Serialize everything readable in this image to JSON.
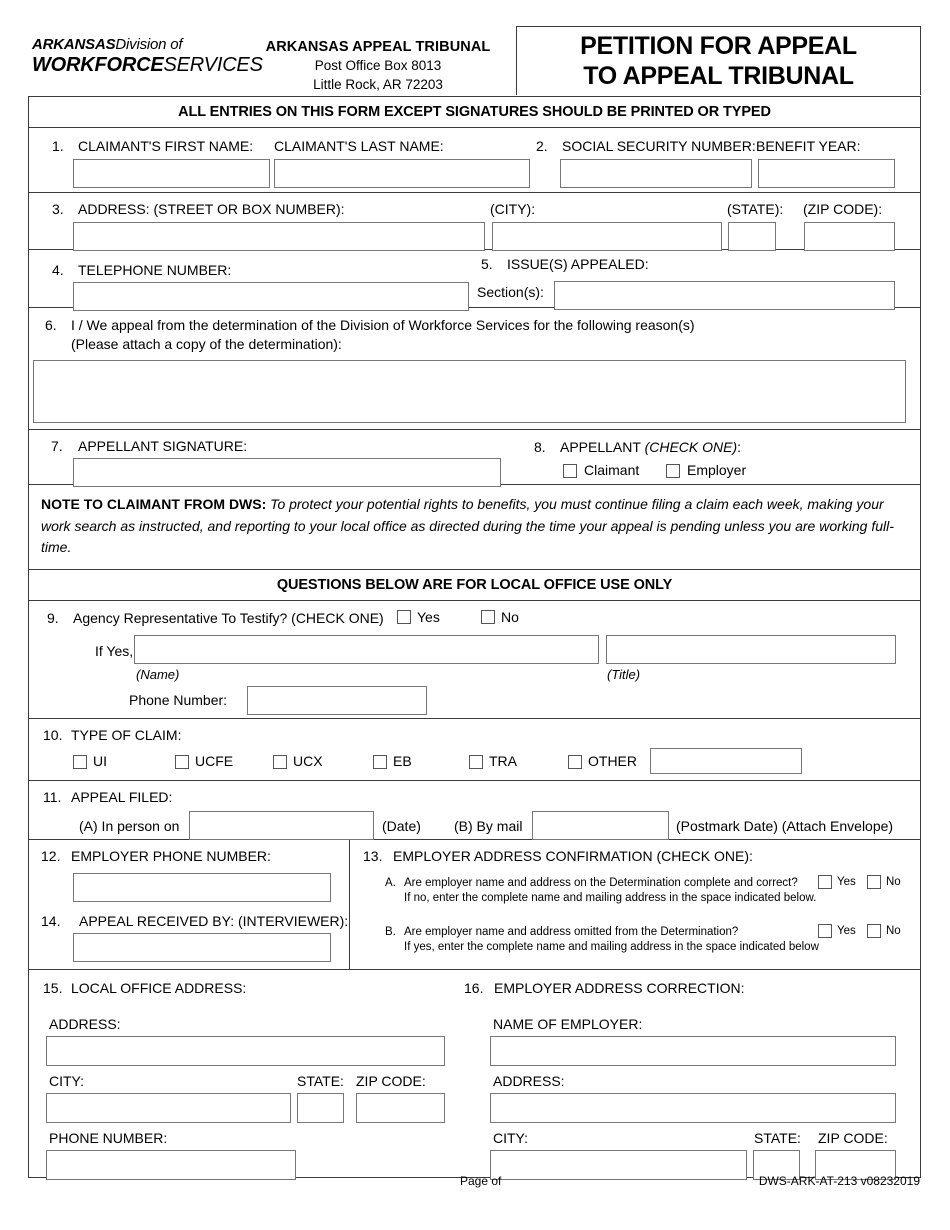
{
  "header": {
    "logo_line1_bold": "ARKANSAS",
    "logo_line1_italic": "Division of",
    "logo_line2_bold": "WORKFORCE",
    "logo_line2_italic": "SERVICES",
    "agency_name": "ARKANSAS APPEAL TRIBUNAL",
    "agency_po_box": "Post Office Box 8013",
    "agency_city_state_zip": "Little Rock, AR  72203",
    "title_line1": "PETITION FOR APPEAL",
    "title_line2": "TO APPEAL TRIBUNAL"
  },
  "banners": {
    "printed_or_typed": "ALL ENTRIES ON THIS FORM EXCEPT SIGNATURES SHOULD BE PRINTED OR TYPED",
    "local_office_only": "QUESTIONS BELOW ARE FOR LOCAL OFFICE USE ONLY"
  },
  "item1": {
    "number": "1.",
    "first_name_label": "CLAIMANT'S FIRST NAME:",
    "last_name_label": "CLAIMANT'S LAST NAME:",
    "first_name_value": "",
    "last_name_value": ""
  },
  "item2": {
    "number": "2.",
    "ssn_label": "SOCIAL SECURITY NUMBER:",
    "benefit_year_label": "BENEFIT YEAR:",
    "ssn_value": "",
    "benefit_year_value": ""
  },
  "item3": {
    "number": "3.",
    "address_label": "ADDRESS: (STREET OR BOX NUMBER):",
    "city_label": "(CITY):",
    "state_label": "(STATE):",
    "zip_label": "(ZIP CODE):",
    "address_value": "",
    "city_value": "",
    "state_value": "",
    "zip_value": ""
  },
  "item4": {
    "number": "4.",
    "label": "TELEPHONE NUMBER:",
    "value": ""
  },
  "item5": {
    "number": "5.",
    "label": "ISSUE(S) APPEALED:",
    "sections_label": "Section(s):",
    "sections_value": ""
  },
  "item6": {
    "number": "6.",
    "line1": "I / We appeal from the determination of the Division of Workforce Services for the following reason(s)",
    "line2": "(Please attach a copy of the determination):",
    "reason_value": ""
  },
  "item7": {
    "number": "7.",
    "label": "APPELLANT SIGNATURE:",
    "value": ""
  },
  "item8": {
    "number": "8.",
    "label_main": "APPELLANT ",
    "label_italic": "(CHECK ONE)",
    "label_tail": ":",
    "options": [
      "Claimant",
      "Employer"
    ]
  },
  "note": {
    "heading": "NOTE TO CLAIMANT FROM DWS:",
    "body": " To protect your potential rights to benefits, you must continue filing a claim each week, making your work search as instructed, and reporting to your local office as directed during the time your appeal is pending unless you are working full-time."
  },
  "item9": {
    "number": "9.",
    "question": "Agency Representative To Testify? (CHECK ONE)",
    "yes_label": "Yes",
    "no_label": "No",
    "if_yes_label": "If Yes,",
    "name_caption": "(Name)",
    "title_caption": "(Title)",
    "phone_label": "Phone Number:",
    "name_value": "",
    "title_value": "",
    "phone_value": ""
  },
  "item10": {
    "number": "10.",
    "label": "TYPE OF CLAIM:",
    "options": [
      "UI",
      "UCFE",
      "UCX",
      "EB",
      "TRA",
      "OTHER"
    ],
    "other_value": ""
  },
  "item11": {
    "number": "11.",
    "label": "APPEAL FILED:",
    "a_label": "(A)  In person on",
    "a_caption": "(Date)",
    "b_label": "(B)  By mail",
    "b_caption": "(Postmark Date) (Attach Envelope)",
    "a_value": "",
    "b_value": ""
  },
  "item12": {
    "number": "12.",
    "label": "EMPLOYER PHONE NUMBER:",
    "value": ""
  },
  "item13": {
    "number": "13.",
    "label": "EMPLOYER ADDRESS CONFIRMATION (CHECK ONE):",
    "a_letter": "A.",
    "a_line1": "Are employer name and address on the Determination complete and correct?",
    "a_line2": "If no, enter the complete name and mailing address in the space indicated below.",
    "b_letter": "B.",
    "b_line1": "Are employer name and address omitted from the Determination?",
    "b_line2": "If yes, enter the complete name and mailing address in the space indicated below",
    "yes_label": "Yes",
    "no_label": "No"
  },
  "item14": {
    "number": "14.",
    "label": "APPEAL RECEIVED BY: (INTERVIEWER):",
    "value": ""
  },
  "item15": {
    "number": "15.",
    "label": "LOCAL OFFICE ADDRESS:",
    "address_label": "ADDRESS:",
    "city_label": "CITY:",
    "state_label": "STATE:",
    "zip_label": "ZIP CODE:",
    "phone_label": "PHONE NUMBER:",
    "address_value": "",
    "city_value": "",
    "state_value": "",
    "zip_value": "",
    "phone_value": ""
  },
  "item16": {
    "number": "16.",
    "label": "EMPLOYER ADDRESS CORRECTION:",
    "name_label": "NAME OF EMPLOYER:",
    "address_label": "ADDRESS:",
    "city_label": "CITY:",
    "state_label": "STATE:",
    "zip_label": "ZIP CODE:",
    "name_value": "",
    "address_value": "",
    "city_value": "",
    "state_value": "",
    "zip_value": ""
  },
  "footer": {
    "page": "Page  of",
    "form_code": "DWS-ARK-AT-213 v08232019"
  }
}
